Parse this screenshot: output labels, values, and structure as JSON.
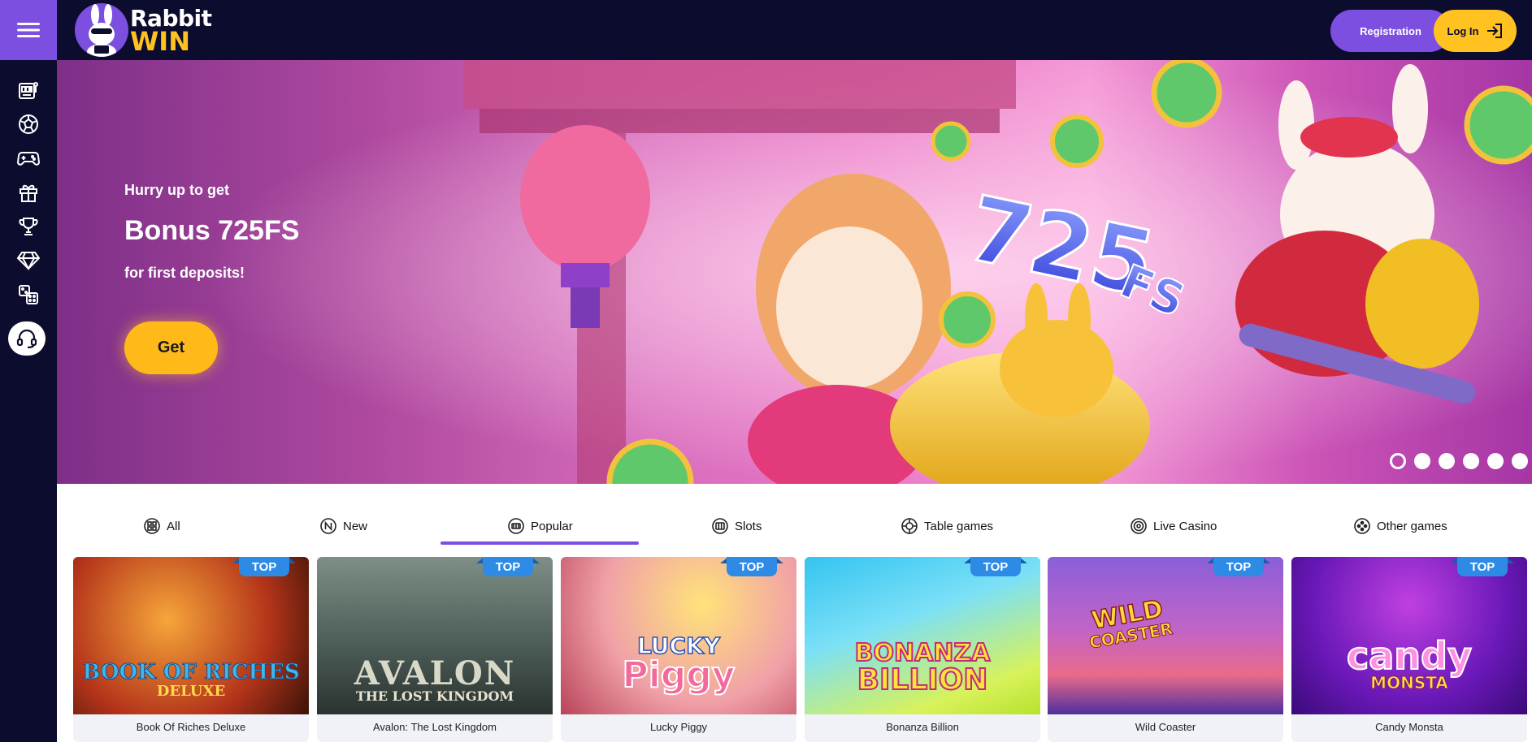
{
  "header": {
    "logo_line1": "Rabbit",
    "logo_line2": "WIN",
    "registration_label": "Registration",
    "login_label": "Log In"
  },
  "sidebar": {
    "items": [
      {
        "icon": "slot-machine-icon"
      },
      {
        "icon": "soccer-ball-icon"
      },
      {
        "icon": "gamepad-icon"
      },
      {
        "icon": "gift-icon"
      },
      {
        "icon": "trophy-icon"
      },
      {
        "icon": "diamond-icon"
      },
      {
        "icon": "dice-icon"
      }
    ],
    "support_icon": "headset-icon"
  },
  "banner": {
    "hurry": "Hurry up to get",
    "bonus": "Bonus 725FS",
    "first": "for first deposits!",
    "get_label": "Get",
    "art_text": "725",
    "art_suffix": "FS",
    "slides_count": 6,
    "active_slide": 1
  },
  "tabs": {
    "items": [
      {
        "label": "All",
        "icon": "grid-icon"
      },
      {
        "label": "New",
        "icon": "new-icon"
      },
      {
        "label": "Popular",
        "icon": "popular-icon"
      },
      {
        "label": "Slots",
        "icon": "slots-icon"
      },
      {
        "label": "Table games",
        "icon": "table-games-icon"
      },
      {
        "label": "Live Casino",
        "icon": "live-casino-icon"
      },
      {
        "label": "Other games",
        "icon": "other-games-icon"
      }
    ],
    "active": "Popular"
  },
  "games": {
    "badge": "TOP",
    "items": [
      {
        "name": "Book Of Riches Deluxe",
        "art_line1": "BOOK OF RICHES",
        "art_line2": "DELUXE"
      },
      {
        "name": "Avalon: The Lost Kingdom",
        "art_line1": "AVALON",
        "art_line2": "THE LOST KINGDOM"
      },
      {
        "name": "Lucky Piggy",
        "art_line1": "LUCKY",
        "art_line2": "Piggy"
      },
      {
        "name": "Bonanza Billion",
        "art_line1": "BONANZA",
        "art_line2": "BILLION"
      },
      {
        "name": "Wild Coaster",
        "art_line1": "WILD",
        "art_line2": "COASTER"
      },
      {
        "name": "Candy Monsta",
        "art_line1": "candy",
        "art_line2": "MONSTA"
      }
    ]
  },
  "colors": {
    "nav_bg": "#0c0c2e",
    "accent_purple": "#7d4fe0",
    "accent_yellow": "#ffc220",
    "badge_blue": "#2d8ae5"
  }
}
